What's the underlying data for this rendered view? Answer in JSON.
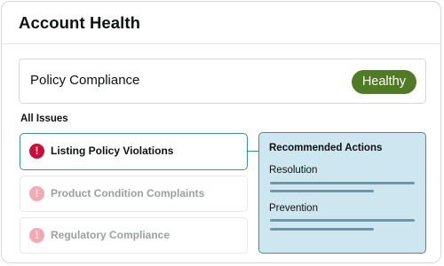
{
  "header": {
    "title": "Account Health"
  },
  "compliance": {
    "label": "Policy Compliance",
    "status": "Healthy",
    "status_color": "#507a24"
  },
  "issues_section": {
    "label": "All Issues",
    "items": [
      {
        "label": "Listing Policy Violations",
        "icon": "alert-icon",
        "state": "selected"
      },
      {
        "label": "Product Condition Complaints",
        "icon": "alert-icon",
        "state": "dimmed"
      },
      {
        "label": "Regulatory Compliance",
        "icon": "alert-icon",
        "state": "dimmed"
      }
    ]
  },
  "recommended_actions": {
    "title": "Recommended Actions",
    "sections": [
      {
        "label": "Resolution"
      },
      {
        "label": "Prevention"
      }
    ]
  },
  "colors": {
    "accent_teal": "#3f8f9d",
    "panel_background": "#cde6ef",
    "alert_red": "#cc0c39",
    "alert_red_dimmed": "#f4a9b4"
  },
  "icons": {
    "alert_glyph": "!"
  }
}
